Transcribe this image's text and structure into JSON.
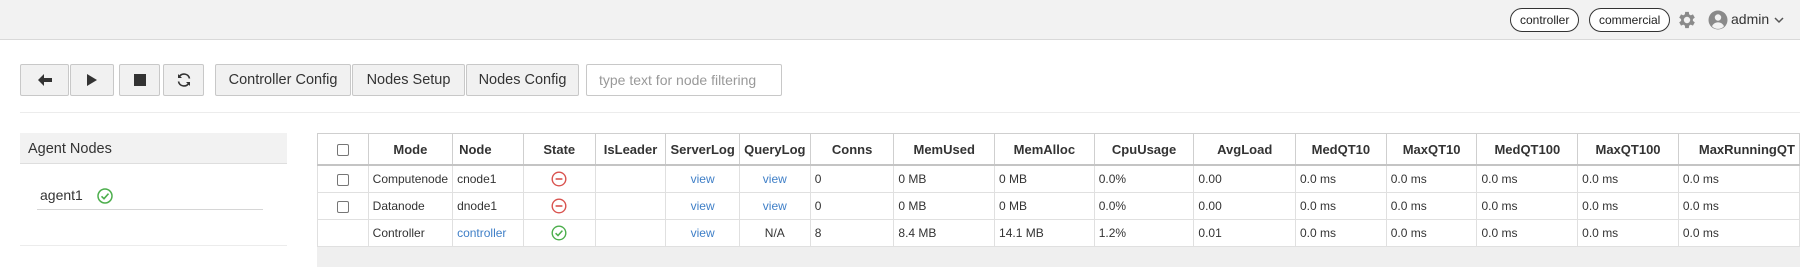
{
  "header": {
    "badges": [
      "controller",
      "commercial"
    ],
    "user": "admin",
    "icons": {
      "settings": "gear-icon",
      "user": "user-circle-icon",
      "dropdown": "chevron-down-icon"
    }
  },
  "toolbar": {
    "icon_buttons": [
      "arrow-left-icon",
      "play-icon",
      "stop-icon",
      "refresh-icon"
    ],
    "buttons": [
      "Controller Config",
      "Nodes Setup",
      "Nodes Config"
    ],
    "filter_placeholder": "type text for node filtering",
    "filter_value": ""
  },
  "agent_panel": {
    "title": "Agent Nodes",
    "agents": [
      {
        "name": "agent1",
        "status": "ok"
      }
    ]
  },
  "table": {
    "columns": [
      "Mode",
      "Node",
      "State",
      "IsLeader",
      "ServerLog",
      "QueryLog",
      "Conns",
      "MemUsed",
      "MemAlloc",
      "CpuUsage",
      "AvgLoad",
      "MedQT10",
      "MaxQT10",
      "MedQT100",
      "MaxQT100",
      "MaxRunningQT"
    ],
    "rows": [
      {
        "mode": "Computenode",
        "node": "cnode1",
        "state": "stopped",
        "is_leader": "",
        "server_log": "view",
        "query_log": "view",
        "conns": "0",
        "mem_used": "0 MB",
        "mem_alloc": "0 MB",
        "cpu_usage": "0.0%",
        "avg_load": "0.00",
        "med_qt10": "0.0 ms",
        "max_qt10": "0.0 ms",
        "med_qt100": "0.0 ms",
        "max_qt100": "0.0 ms",
        "max_running_qt": "0.0 ms"
      },
      {
        "mode": "Datanode",
        "node": "dnode1",
        "state": "stopped",
        "is_leader": "",
        "server_log": "view",
        "query_log": "view",
        "conns": "0",
        "mem_used": "0 MB",
        "mem_alloc": "0 MB",
        "cpu_usage": "0.0%",
        "avg_load": "0.00",
        "med_qt10": "0.0 ms",
        "max_qt10": "0.0 ms",
        "med_qt100": "0.0 ms",
        "max_qt100": "0.0 ms",
        "max_running_qt": "0.0 ms"
      },
      {
        "mode": "Controller",
        "node": "controller",
        "state": "running",
        "is_leader": "",
        "server_log": "view",
        "query_log": "N/A",
        "conns": "8",
        "mem_used": "8.4 MB",
        "mem_alloc": "14.1 MB",
        "cpu_usage": "1.2%",
        "avg_load": "0.01",
        "med_qt10": "0.0 ms",
        "max_qt10": "0.0 ms",
        "med_qt100": "0.0 ms",
        "max_qt100": "0.0 ms",
        "max_running_qt": "0.0 ms"
      }
    ]
  },
  "colors": {
    "link": "#3f7fc7",
    "stopped": "#d9534f",
    "running": "#4cae4c",
    "header_bg": "#f2f2f2"
  }
}
